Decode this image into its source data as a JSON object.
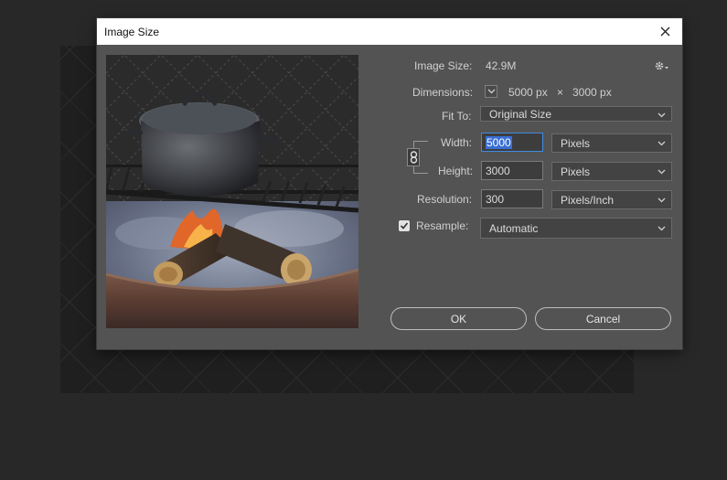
{
  "dialog": {
    "title": "Image Size"
  },
  "info": {
    "image_size_label": "Image Size:",
    "image_size_value": "42.9M",
    "dimensions_label": "Dimensions:",
    "dimensions_width": "5000 px",
    "dimensions_sep": "×",
    "dimensions_height": "3000 px"
  },
  "fit_to": {
    "label": "Fit To:",
    "value": "Original Size"
  },
  "width": {
    "label": "Width:",
    "value": "5000",
    "unit": "Pixels"
  },
  "height": {
    "label": "Height:",
    "value": "3000",
    "unit": "Pixels"
  },
  "resolution": {
    "label": "Resolution:",
    "value": "300",
    "unit": "Pixels/Inch"
  },
  "resample": {
    "label": "Resample:",
    "checked": true,
    "value": "Automatic"
  },
  "buttons": {
    "ok": "OK",
    "cancel": "Cancel"
  },
  "icons": {
    "close": "close-icon",
    "gear": "gear-icon",
    "link": "link-icon",
    "chevron": "chevron-down-icon",
    "check": "check-icon"
  },
  "colors": {
    "dialog_bg": "#535353",
    "selection": "#3a6fd4",
    "focus_border": "#3f8be0"
  }
}
